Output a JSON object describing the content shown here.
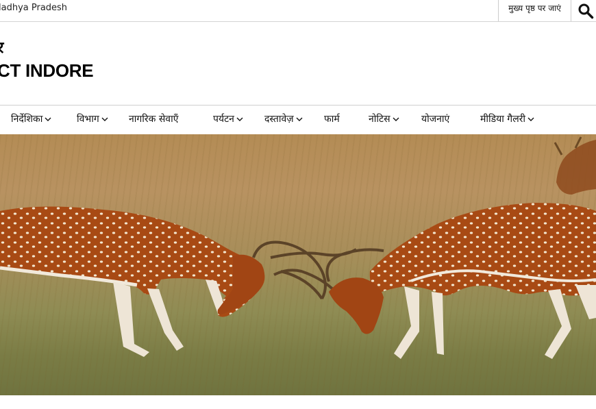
{
  "topbar": {
    "state_name": "ladhya Pradesh",
    "home_link": "मुख्य पृष्ठ पर जाएं"
  },
  "brand": {
    "title_hindi": "र",
    "title_english": "CT INDORE"
  },
  "nav": {
    "items": [
      {
        "label": "निर्देशिका",
        "has_dropdown": true
      },
      {
        "label": "विभाग",
        "has_dropdown": true
      },
      {
        "label": "नागरिक सेवाएँ",
        "has_dropdown": false
      },
      {
        "label": "पर्यटन",
        "has_dropdown": true
      },
      {
        "label": "दस्तावेज़",
        "has_dropdown": true
      },
      {
        "label": "फार्म",
        "has_dropdown": false
      },
      {
        "label": "नोटिस",
        "has_dropdown": true
      },
      {
        "label": "योजनाएं",
        "has_dropdown": false
      },
      {
        "label": "मीडिया गैलरी",
        "has_dropdown": true
      }
    ]
  },
  "icons": {
    "search": "search-icon",
    "dropdown": "chevron-down-icon"
  },
  "colors": {
    "border": "#d4d4d4",
    "text": "#111111",
    "deer": "#a84a14",
    "grass": "#7a7c45"
  },
  "hero": {
    "image": "two spotted deer sparring in grassland"
  }
}
